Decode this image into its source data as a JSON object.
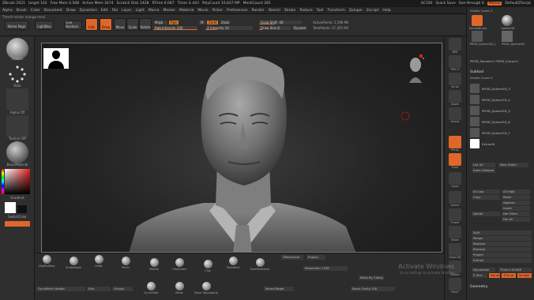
{
  "titlebar": {
    "app": "ZBrush 2021",
    "file": "target 102",
    "stats": [
      "Free Mem 4.56B",
      "Active Mem 3474",
      "Scratch Disk 1428",
      "RTime 6.087",
      "Timer 4.443",
      "PolyCount 10.837 MP",
      "MeshCount 281"
    ],
    "right_items": [
      "AC100",
      "Quick Save"
    ],
    "see_through": "See-through 0",
    "menus_btn": "Menus",
    "ui_label": "DefaultZScript"
  },
  "menubar": {
    "items": [
      "Alpha",
      "Brush",
      "Color",
      "Document",
      "Draw",
      "Dynamics",
      "Edit",
      "File",
      "Layer",
      "Light",
      "Macro",
      "Marker",
      "Material",
      "Movie",
      "Picker",
      "Preferences",
      "Render",
      "Stencil",
      "Stroke",
      "Texture",
      "Tool",
      "Transform",
      "Zplugin",
      "Zscript",
      "Help"
    ]
  },
  "toolbar": {
    "hint": "Tmerit render orange mest",
    "buttons": [
      "Home Page",
      "LightBox",
      "Live Boolean",
      "Edit",
      "Draw",
      "Move",
      "Scale",
      "Rotate"
    ],
    "sliders": {
      "mrgb": "Mrgb",
      "rgb": "Rgb",
      "rgb_intensity": "Rgb Intensity 100",
      "m": "M",
      "zadd": "Zadd",
      "zsub": "Zsub",
      "z_intensity": "Z Intensity 24",
      "focal_shift": "Focal Shift -40",
      "draw_size": "Draw Size 8",
      "dynamic": "Dynamic",
      "active_points": "ActivePoints: 2,596 Mil",
      "total_points": "TotalPoints: 27,455 Mil"
    }
  },
  "leftshelf": {
    "labels": [
      "Flatten",
      "Dots",
      "Alpha Off",
      "Texture Off",
      "BasicMaterial"
    ],
    "color_label": "Gradient",
    "switch_label": "SwitchColor"
  },
  "rightcol": {
    "labels": [
      "BPR",
      "SPix 3",
      "Scroll",
      "Zoom",
      "Actual",
      "AAHalf",
      "Persp",
      "Floor",
      "Local",
      "Gizmo",
      "Frame",
      "Move",
      "Zoom3D",
      "Rotate",
      "Line Fill",
      "PolyF",
      "Transp",
      "Ghost",
      "Solo",
      "Xpose"
    ]
  },
  "subtool": {
    "header": "Visible Count 3",
    "tool_names": [
      "SimpleBrush",
      "Sphere3D",
      "PM3D_Sphere3D_1",
      "PM3D_Sphere3D"
    ],
    "current_tool": "PM3D_Manekin1 PM3D_Extract1",
    "section_title": "Subtool",
    "visible_count": "Visible Count 9",
    "items": [
      "PM3D_Sphere3D_3",
      "PM3D_Sphere3D_4",
      "PM3D_Sphere3D_5",
      "PM3D_Sphere3D_6",
      "PM3D_Sphere3D_7",
      "Extract8"
    ],
    "buttons": [
      "List All",
      "New Folder",
      "Auto Collapse",
      "All Low",
      "All High",
      "Copy",
      "Paste",
      "Append",
      "Insert",
      "Delete",
      "Del Other",
      "Del All",
      "Split",
      "Merge",
      "Boolean",
      "Remesh",
      "Project",
      "Extract",
      "Geometry"
    ],
    "footer": {
      "dynamesh": "Dynamesh",
      "thick": "Thick 0.00458",
      "s_smt": "S Smt",
      "double": "Double",
      "tcorne": "TCorne",
      "accept": "Accept"
    }
  },
  "bottom": {
    "brushes": [
      "ClayBuildup",
      "SnakeHook",
      "Inflat",
      "Pinch",
      "hPolish",
      "ClayTubes",
      "Clay",
      "Standard",
      "DamStandard",
      "Move",
      "Move Topological",
      "CurveTube"
    ],
    "sliders": {
      "dynamesh_master": "DynaMesh Master",
      "resolution": "Resolution 1258",
      "mask_by_cavity": "Mask By Cavity",
      "mask_cavity_slider": "Mask Cavity 100",
      "morph_target": "MorphTarget",
      "blur": "Blur",
      "groups": "Groups",
      "zremesher": "ZRemesher",
      "project": "Project"
    }
  },
  "watermark": {
    "line1": "Activate Windows",
    "line2": "Go to Settings to activate Windows."
  },
  "colors": {
    "accent": "#e0662a",
    "panel": "#2c2c2c",
    "canvas": "#1f1f1f"
  }
}
